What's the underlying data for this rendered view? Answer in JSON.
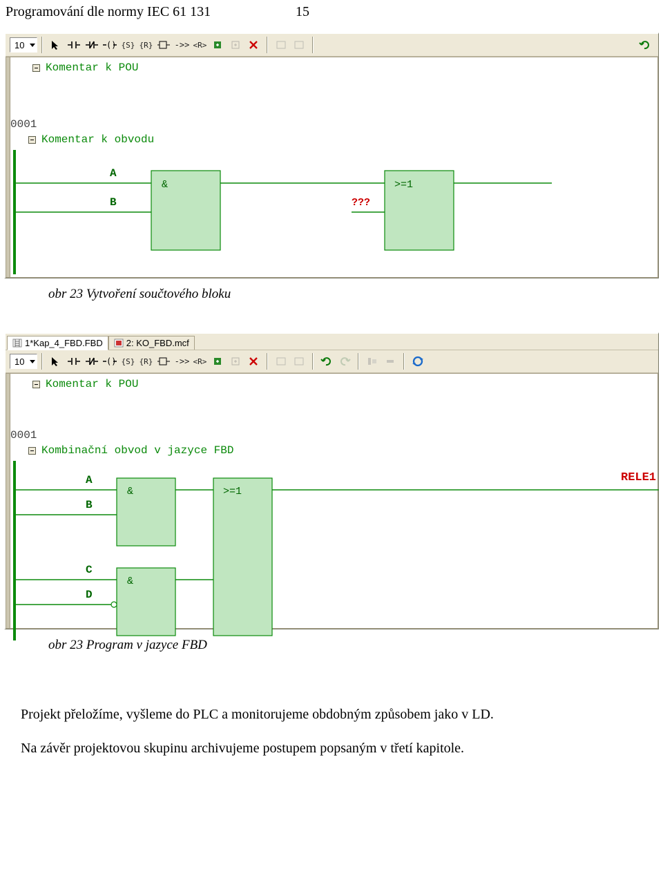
{
  "header": {
    "title": "Programování dle normy IEC 61 131",
    "page": "15"
  },
  "fig1": {
    "zoom": "10",
    "icons": [
      "pointer",
      "contact-no",
      "contact-nc",
      "coil",
      "set",
      "reset",
      "box",
      "jump",
      "return",
      "block-new",
      "block-insert",
      "block-delete",
      "tool-a",
      "tool-b",
      "undo"
    ],
    "pou_comment": "Komentar k POU",
    "rung": "0001",
    "rung_comment": "Komentar k obvodu",
    "fbd": {
      "var_a": "A",
      "var_b": "B",
      "block1": "&",
      "block2": ">=1",
      "missing": "???"
    },
    "caption": "obr 23 Vytvoření součtového bloku"
  },
  "fig2": {
    "tabs": [
      {
        "label": "1*Kap_4_FBD.FBD",
        "active": true
      },
      {
        "label": "2: KO_FBD.mcf",
        "active": false
      }
    ],
    "zoom": "10",
    "icons_g2": [
      "pointer",
      "contact-no",
      "contact-nc",
      "coil",
      "set",
      "reset",
      "box",
      "jump",
      "return",
      "block-new",
      "block-insert",
      "block-delete"
    ],
    "icons_g3": [
      "tool-a",
      "tool-b"
    ],
    "icons_g4": [
      "undo",
      "redo"
    ],
    "icons_g5": [
      "align-left",
      "align-middle"
    ],
    "icons_g6": [
      "rebuild"
    ],
    "pou_comment": "Komentar k POU",
    "rung": "0001",
    "rung_comment": "Kombinační obvod v jazyce FBD",
    "fbd": {
      "var_a": "A",
      "var_b": "B",
      "var_c": "C",
      "var_d": "D",
      "block1": "&",
      "block2": "&",
      "block3": ">=1",
      "output": "RELE1"
    },
    "caption": "obr 23 Program v jazyce FBD"
  },
  "text": {
    "p1": "Projekt přeložíme, vyšleme do PLC a monitorujeme obdobným způsobem jako v LD.",
    "p2": "Na závěr projektovou skupinu archivujeme postupem popsaným v třetí kapitole."
  }
}
